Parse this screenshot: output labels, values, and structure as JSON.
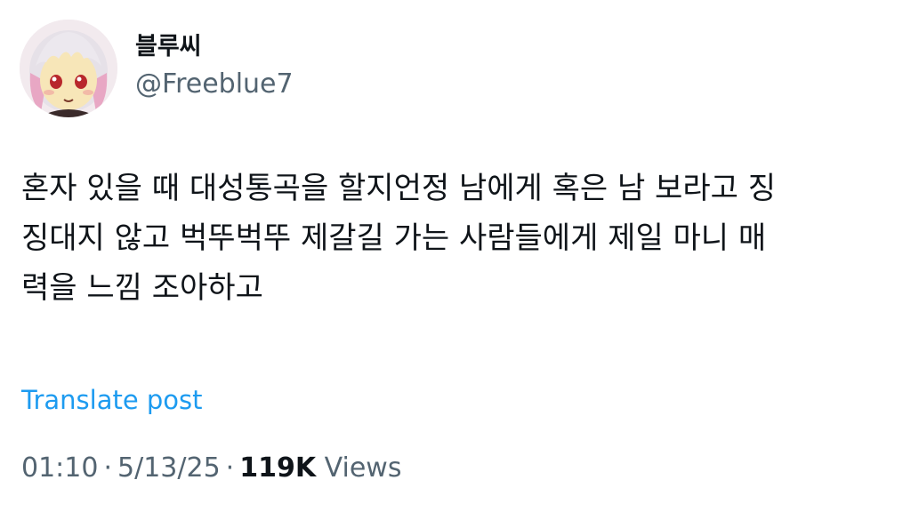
{
  "author": {
    "display_name": "블루씨",
    "handle": "@Freeblue7",
    "avatar_icon": "anime-girl-avatar"
  },
  "post": {
    "lines": [
      "혼자 있을 때 대성통곡을 할지언정 남에게 혹은 남 보라고 징",
      "징대지 않고 벅뚜벅뚜 제갈길 가는 사람들에게 제일 마니 매",
      "력을 느낌 조아하고"
    ],
    "translate_label": "Translate post"
  },
  "meta": {
    "time": "01:10",
    "separator": "·",
    "date": "5/13/25",
    "views_count": "119K",
    "views_label": "Views"
  },
  "colors": {
    "text": "#0f1419",
    "secondary": "#536471",
    "link": "#1d9bf0"
  }
}
